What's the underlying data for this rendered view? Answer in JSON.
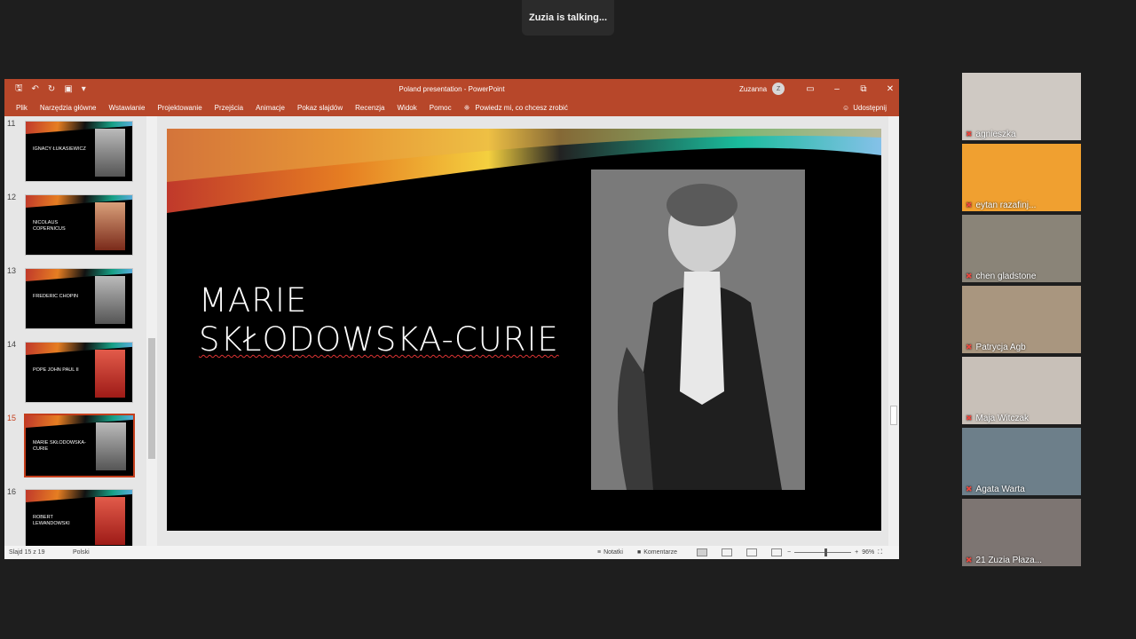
{
  "meeting": {
    "talking_label": "Zuzia is talking..."
  },
  "ppt": {
    "doc_title": "Poland presentation  -  PowerPoint",
    "user_name": "Zuzanna",
    "user_initial": "Z",
    "qat_more": "▾",
    "ribbon_tabs": [
      "Plik",
      "Narzędzia główne",
      "Wstawianie",
      "Projektowanie",
      "Przejścia",
      "Animacje",
      "Pokaz slajdów",
      "Recenzja",
      "Widok",
      "Pomoc"
    ],
    "tell_me": "Powiedz mi, co chcesz zrobić",
    "share": "Udostępnij",
    "thumbnails": [
      {
        "num": "11",
        "label": "IGNACY ŁUKASIEWICZ"
      },
      {
        "num": "12",
        "label": "NICOLAUS COPERNICUS"
      },
      {
        "num": "13",
        "label": "FREDERIC CHOPIN"
      },
      {
        "num": "14",
        "label": "POPE JOHN PAUL II"
      },
      {
        "num": "15",
        "label": "MARIE SKŁODOWSKA-CURIE"
      },
      {
        "num": "16",
        "label": "ROBERT LEWANDOWSKI"
      }
    ],
    "active_thumbnail": "15",
    "slide": {
      "title_line1": "MARIE",
      "title_line2": "SKŁODOWSKA-CURIE"
    },
    "status": {
      "slide_count": "Slajd 15 z 19",
      "language": "Polski",
      "notes": "Notatki",
      "comments": "Komentarze",
      "zoom_minus": "−",
      "zoom_plus": "+",
      "zoom": "96%"
    }
  },
  "participants": [
    {
      "name": "agnieszka",
      "bg": "#cfc9c3"
    },
    {
      "name": "eytan razafinj...",
      "bg": "#f0a030"
    },
    {
      "name": "chen gladstone",
      "bg": "#8a8478"
    },
    {
      "name": "Patrycja Agb",
      "bg": "#a9967f"
    },
    {
      "name": "Maja Witczak",
      "bg": "#c8c0b8"
    },
    {
      "name": "Agata Warta",
      "bg": "#6d7f8a"
    },
    {
      "name": "21 Zuzia Płaza...",
      "bg": "#7d7572"
    }
  ]
}
